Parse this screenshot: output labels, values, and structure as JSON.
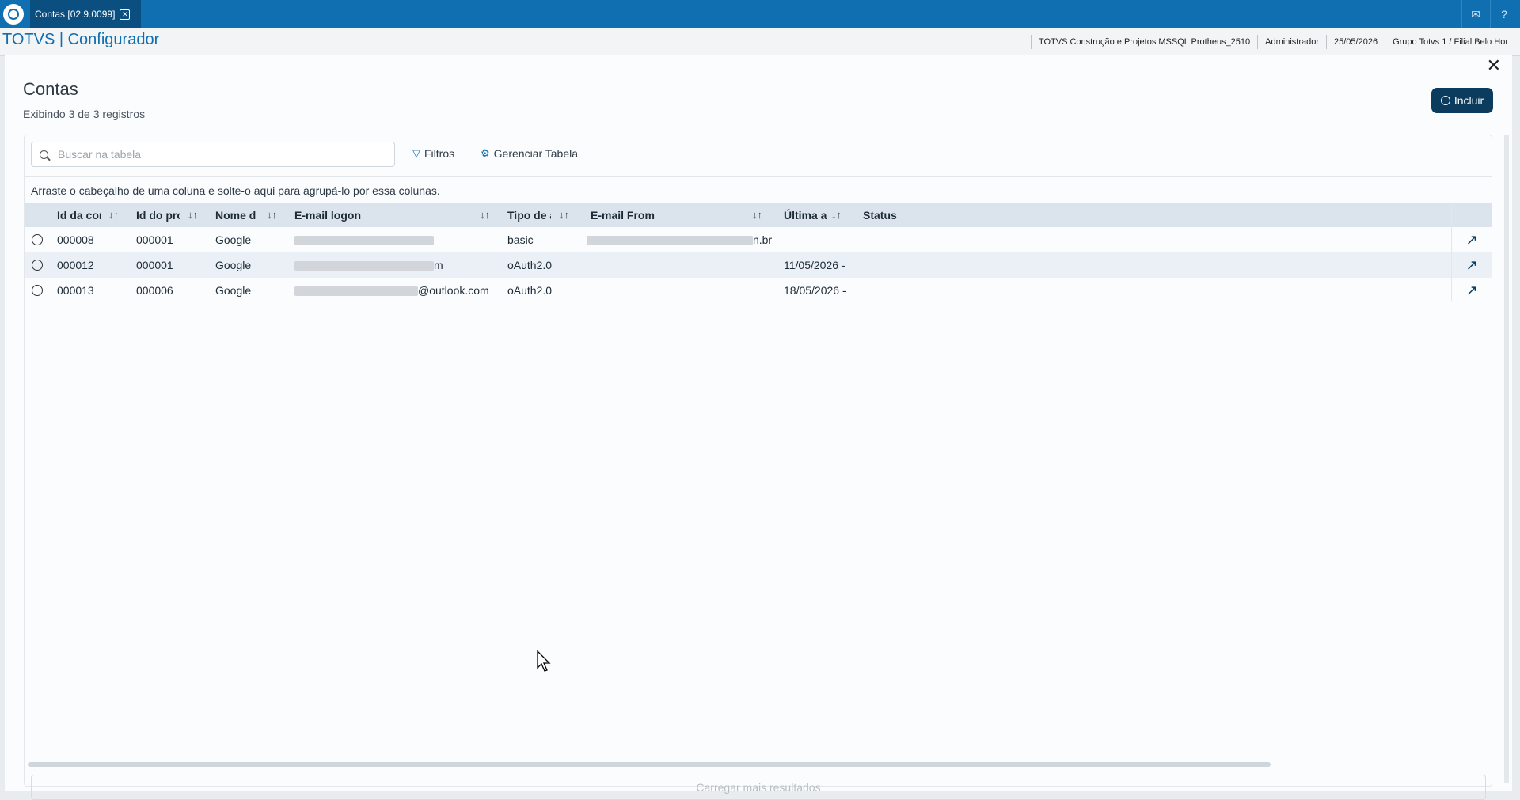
{
  "tab": {
    "label": "Contas [02.9.0099]",
    "close": "✕"
  },
  "brand": "TOTVS | Configurador",
  "info": [
    "TOTVS Construção e Projetos MSSQL Protheus_2510",
    "Administrador",
    "25/05/2026",
    "Grupo Totvs 1 / Filial Belo Hor"
  ],
  "page": {
    "title": "Contas",
    "subtitle": "Exibindo 3 de 3 registros",
    "include_label": "Incluir"
  },
  "toolbar": {
    "search_placeholder": "Buscar na tabela",
    "filters_label": "Filtros",
    "manage_label": "Gerenciar Tabela"
  },
  "group_hint": "Arraste o cabeçalho de uma coluna e solte-o aqui para agrupá-lo por essa colunas.",
  "columns": [
    "Id da cor",
    "Id do prc",
    "Nome d",
    "E-mail logon",
    "Tipo de a",
    "E-mail From",
    "Última a",
    "Status"
  ],
  "rows": [
    {
      "id": "000008",
      "prov": "000001",
      "name": "Google",
      "logon_suffix": "",
      "tipo": "basic",
      "from_suffix": "n.br",
      "ultima": "",
      "status": ""
    },
    {
      "id": "000012",
      "prov": "000001",
      "name": "Google",
      "logon_suffix": "m",
      "tipo": "oAuth2.0",
      "from_suffix": "",
      "ultima": "11/05/2026 -",
      "status": ""
    },
    {
      "id": "000013",
      "prov": "000006",
      "name": "Google",
      "logon_suffix": "@outlook.com",
      "tipo": "oAuth2.0",
      "from_suffix": "",
      "ultima": "18/05/2026 -",
      "status": ""
    }
  ],
  "load_more": "Carregar mais resultados",
  "close_glyph": "✕",
  "sort_glyph": "↓↑",
  "row_action_glyph": "↗",
  "colors": {
    "topbar": "#0f6fb0",
    "primary_button": "#0b3c5d"
  }
}
